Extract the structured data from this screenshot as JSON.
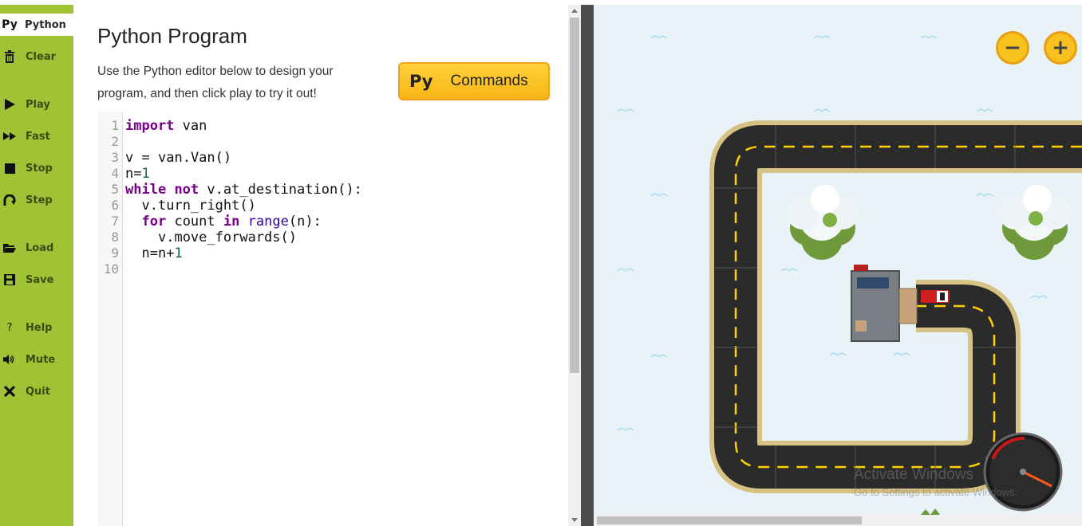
{
  "sidebar": {
    "items": [
      {
        "icon": "Py",
        "label": "Python",
        "icon_name": "python-icon"
      },
      {
        "icon": "🗑",
        "label": "Clear",
        "icon_name": "trash-icon"
      },
      {
        "icon": "▶",
        "label": "Play",
        "icon_name": "play-icon"
      },
      {
        "icon": "▶▶",
        "label": "Fast",
        "icon_name": "fast-forward-icon"
      },
      {
        "icon": "■",
        "label": "Stop",
        "icon_name": "stop-icon"
      },
      {
        "icon": "↷",
        "label": "Step",
        "icon_name": "step-icon"
      },
      {
        "icon": "📂",
        "label": "Load",
        "icon_name": "folder-icon"
      },
      {
        "icon": "💾",
        "label": "Save",
        "icon_name": "floppy-icon"
      },
      {
        "icon": "?",
        "label": "Help",
        "icon_name": "help-icon"
      },
      {
        "icon": "🔊",
        "label": "Mute",
        "icon_name": "speaker-icon"
      },
      {
        "icon": "✖",
        "label": "Quit",
        "icon_name": "close-icon"
      }
    ],
    "accent": "#a0c335"
  },
  "panel": {
    "title": "Python Program",
    "description": "Use the Python editor below to design your program, and then click play to try it out!",
    "commands_button": {
      "icon": "Py",
      "label": "Commands",
      "color": "#f8b514"
    }
  },
  "editor": {
    "line_numbers": [
      "1",
      "2",
      "3",
      "4",
      "5",
      "6",
      "7",
      "8",
      "9",
      "10"
    ],
    "lines": [
      "import van",
      "",
      "v = van.Van()",
      "n=1",
      "while not v.at_destination():",
      "  v.turn_right()",
      "  for count in range(n):",
      "    v.move_forwards()",
      "  n=n+1",
      ""
    ]
  },
  "game": {
    "zoom_out_label": "−",
    "zoom_in_label": "+",
    "watermark_title": "Activate Windows",
    "watermark_sub": "Go to Settings to activate Windows.",
    "road_color": "#2b2b2b",
    "lane_color": "#ffd200",
    "background": "#e9f2f6"
  }
}
